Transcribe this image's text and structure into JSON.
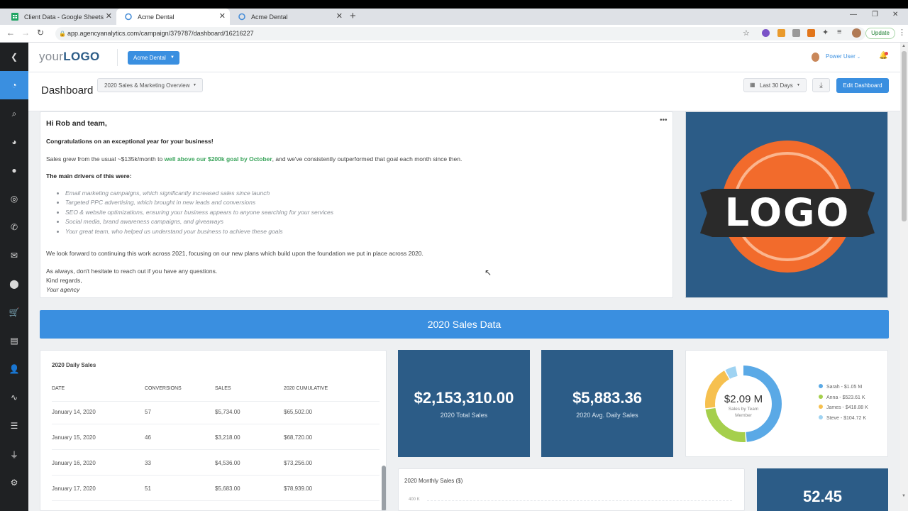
{
  "browser": {
    "tabs": [
      {
        "label": "Client Data - Google Sheets"
      },
      {
        "label": "Acme Dental"
      },
      {
        "label": "Acme Dental"
      }
    ],
    "url": "app.agencyanalytics.com/campaign/379787/dashboard/16216227",
    "update_label": "Update"
  },
  "topnav": {
    "logo_light": "your",
    "logo_bold": "LOGO",
    "campaign_label": "Acme Dental",
    "user_label": "Power User"
  },
  "subbar": {
    "title": "Dashboard",
    "dashboard_select": "2020 Sales & Marketing Overview",
    "date_range": "Last 30 Days",
    "edit_label": "Edit Dashboard"
  },
  "message": {
    "greeting": "Hi Rob and team,",
    "congrats": "Congratulations on an exceptional year for your business!",
    "sales_pre": "Sales grew from the usual ~$135k/month to ",
    "sales_highlight": "well above our $200k goal by October",
    "sales_post": ", and we've consistently outperformed that goal each month since then.",
    "drivers_heading": "The main drivers of this were:",
    "drivers": [
      "Email marketing campaigns, which significantly increased sales since launch",
      "Targeted PPC advertising, which brought in new leads and conversions",
      "SEO & website optimizations, ensuring your business appears to anyone searching for your services",
      "Social media, brand awareness campaigns, and giveaways",
      "Your great team, who helped us understand your business to achieve these goals"
    ],
    "forward": "We look forward to continuing this work across 2021, focusing on our new plans which build upon the foundation we put in place across 2020.",
    "closing1": "As always, don't hesitate to reach out if you have any questions.",
    "closing2": "Kind regards,",
    "signature": "Your agency"
  },
  "logo_card": {
    "text": "LOGO"
  },
  "section_header": "2020 Sales Data",
  "daily_sales": {
    "title": "2020 Daily Sales",
    "columns": [
      "DATE",
      "CONVERSIONS",
      "SALES",
      "2020 CUMULATIVE"
    ],
    "rows": [
      {
        "date": "January 14, 2020",
        "conversions": "57",
        "sales": "$5,734.00",
        "cumulative": "$65,502.00"
      },
      {
        "date": "January 15, 2020",
        "conversions": "46",
        "sales": "$3,218.00",
        "cumulative": "$68,720.00"
      },
      {
        "date": "January 16, 2020",
        "conversions": "33",
        "sales": "$4,536.00",
        "cumulative": "$73,256.00"
      },
      {
        "date": "January 17, 2020",
        "conversions": "51",
        "sales": "$5,683.00",
        "cumulative": "$78,939.00"
      }
    ]
  },
  "stats": [
    {
      "value": "$2,153,310.00",
      "label": "2020 Total Sales"
    },
    {
      "value": "$5,883.36",
      "label": "2020 Avg. Daily Sales"
    },
    {
      "value": "52.45",
      "label": ""
    }
  ],
  "donut": {
    "center_value": "$2.09 M",
    "center_label1": "Sales by Team",
    "center_label2": "Member",
    "legend": [
      {
        "label": "Sarah - $1.05 M",
        "color": "#5aa9e6",
        "fraction": 0.49
      },
      {
        "label": "Anna - $523.61 K",
        "color": "#a5cf4c",
        "fraction": 0.24
      },
      {
        "label": "James - $418.88 K",
        "color": "#f6c04f",
        "fraction": 0.19
      },
      {
        "label": "Steve - $104.72 K",
        "color": "#9fd3f2",
        "fraction": 0.05
      }
    ]
  },
  "monthly_chart": {
    "title": "2020 Monthly Sales ($)",
    "first_tick": "400 K"
  },
  "colors": {
    "accent": "#3a8fe0",
    "stat_bg": "#2c5c87",
    "highlight_green": "#3aa45b"
  }
}
